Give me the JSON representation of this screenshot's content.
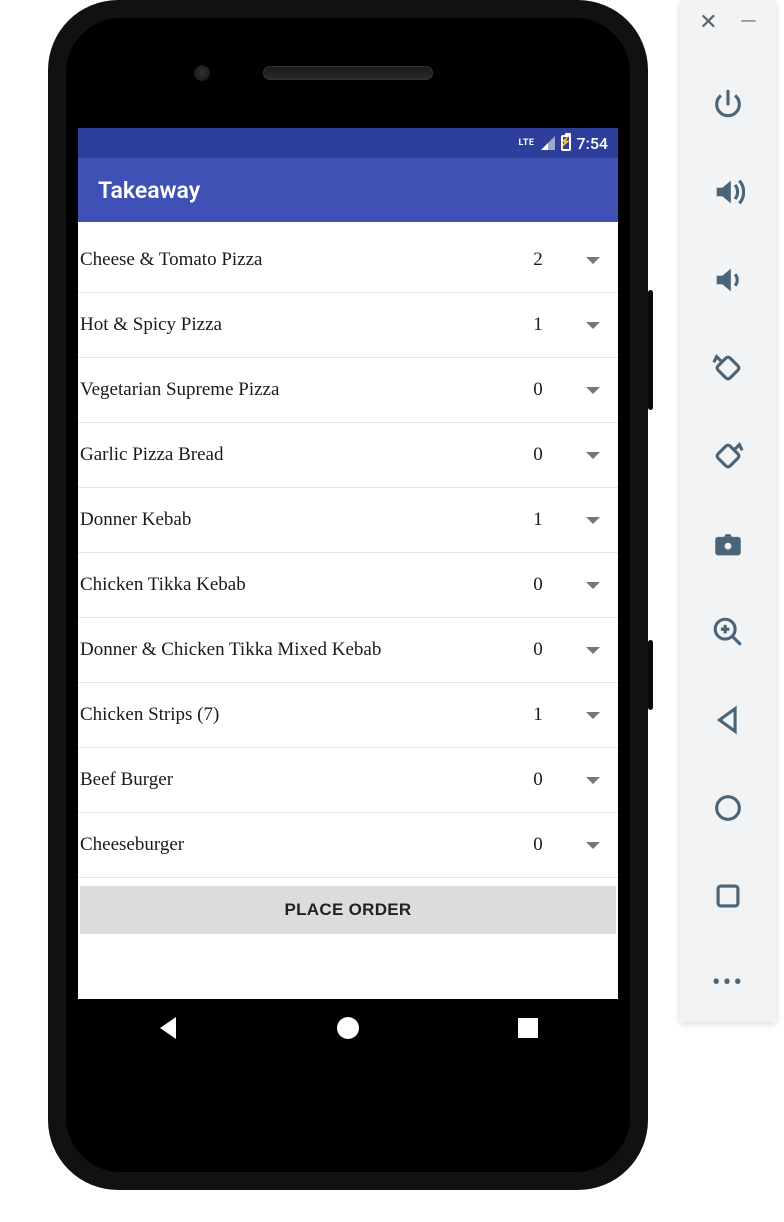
{
  "status": {
    "network": "LTE",
    "time": "7:54"
  },
  "app": {
    "title": "Takeaway"
  },
  "items": [
    {
      "name": "Cheese & Tomato Pizza",
      "qty": "2"
    },
    {
      "name": "Hot & Spicy Pizza",
      "qty": "1"
    },
    {
      "name": "Vegetarian Supreme Pizza",
      "qty": "0"
    },
    {
      "name": "Garlic Pizza Bread",
      "qty": "0"
    },
    {
      "name": "Donner Kebab",
      "qty": "1"
    },
    {
      "name": "Chicken Tikka Kebab",
      "qty": "0"
    },
    {
      "name": "Donner & Chicken Tikka Mixed Kebab",
      "qty": "0"
    },
    {
      "name": "Chicken Strips (7)",
      "qty": "1"
    },
    {
      "name": "Beef Burger",
      "qty": "0"
    },
    {
      "name": "Cheeseburger",
      "qty": "0"
    }
  ],
  "actions": {
    "place_order": "PLACE ORDER"
  },
  "emu": {
    "close": "✕",
    "minimize": "—",
    "more": "•••"
  }
}
